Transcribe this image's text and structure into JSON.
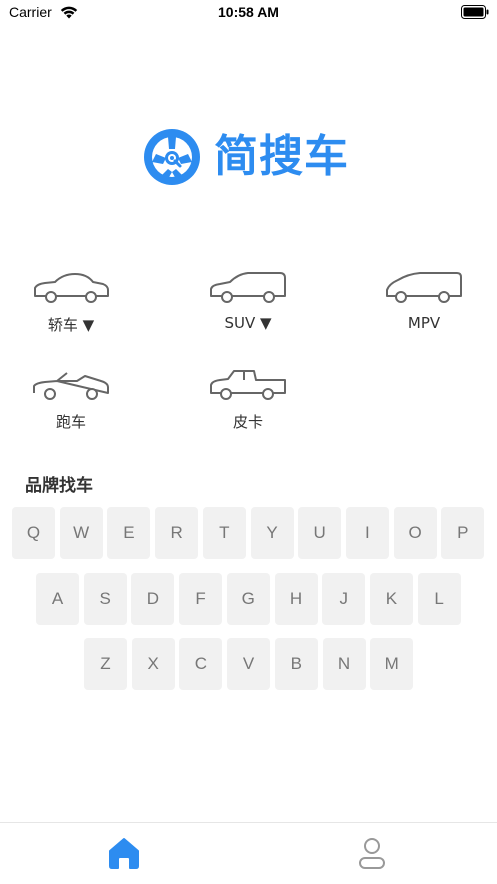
{
  "status_bar": {
    "carrier": "Carrier",
    "time": "10:58 AM"
  },
  "app": {
    "name": "简搜车",
    "brand_color": "#2d8cf0"
  },
  "car_types": [
    {
      "label": "轿车 ▼",
      "icon": "sedan-icon"
    },
    {
      "label": "SUV ▼",
      "icon": "suv-icon"
    },
    {
      "label": "MPV",
      "icon": "mpv-icon"
    },
    {
      "label": "跑车",
      "icon": "sports-car-icon"
    },
    {
      "label": "皮卡",
      "icon": "pickup-icon"
    }
  ],
  "brand_section": {
    "title": "品牌找车"
  },
  "keyboard": {
    "row1": [
      "Q",
      "W",
      "E",
      "R",
      "T",
      "Y",
      "U",
      "I",
      "O",
      "P"
    ],
    "row2": [
      "A",
      "S",
      "D",
      "F",
      "G",
      "H",
      "J",
      "K",
      "L"
    ],
    "row3": [
      "Z",
      "X",
      "C",
      "V",
      "B",
      "N",
      "M"
    ]
  },
  "tab_bar": {
    "home": {
      "icon": "home-icon",
      "active_color": "#2d8cf0"
    },
    "profile": {
      "icon": "user-icon",
      "inactive_color": "#999999"
    }
  }
}
